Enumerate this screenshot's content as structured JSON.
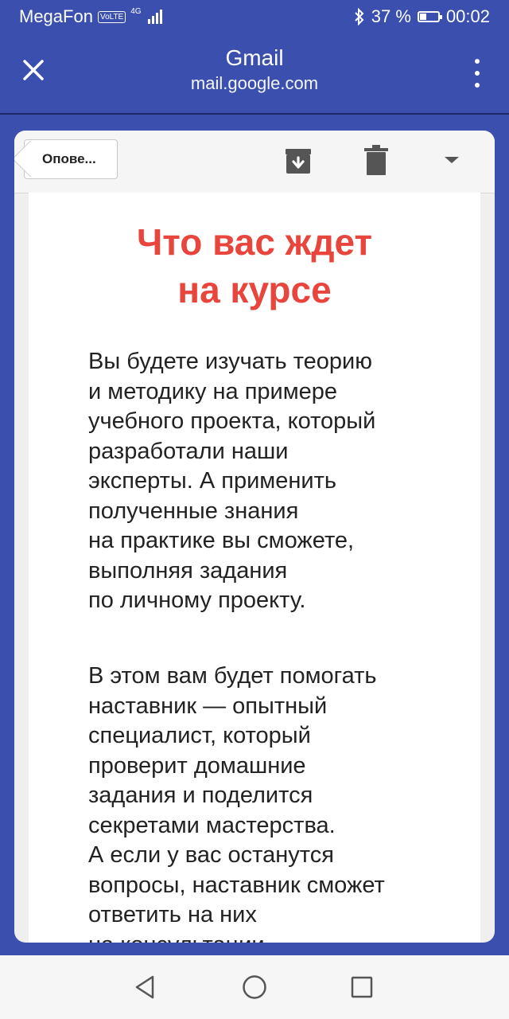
{
  "status_bar": {
    "carrier": "MegaFon",
    "volte": "VoLTE",
    "network": "4G",
    "battery_percent": "37 %",
    "battery_level": 0.37,
    "time": "00:02"
  },
  "header": {
    "title": "Gmail",
    "subtitle": "mail.google.com"
  },
  "toolbar": {
    "back_label": "Опове..."
  },
  "email": {
    "heading": "Что вас ждет\nна курсе",
    "paragraph1": "Вы будете изучать теорию\nи методику на примере\nучебного проекта, который\nразработали наши\nэксперты. А применить\nполученные знания\nна практике вы сможете,\nвыполняя задания\nпо личному проекту.",
    "paragraph2": "В этом вам будет помогать\nнаставник — опытный\nспециалист, который\nпроверит домашние\nзадания и поделится\nсекретами мастерства.\nА если у вас останутся\nвопросы, наставник сможет\nответить на них\nна консультации."
  },
  "icons": {
    "close": "close-icon",
    "menu": "more-vert-icon",
    "archive": "archive-icon",
    "delete": "trash-icon",
    "dropdown": "caret-down-icon",
    "nav_back": "nav-back-icon",
    "nav_home": "nav-home-icon",
    "nav_recent": "nav-recent-icon"
  },
  "colors": {
    "header_bg": "#3a4fae",
    "heading_red": "#e8453c"
  }
}
